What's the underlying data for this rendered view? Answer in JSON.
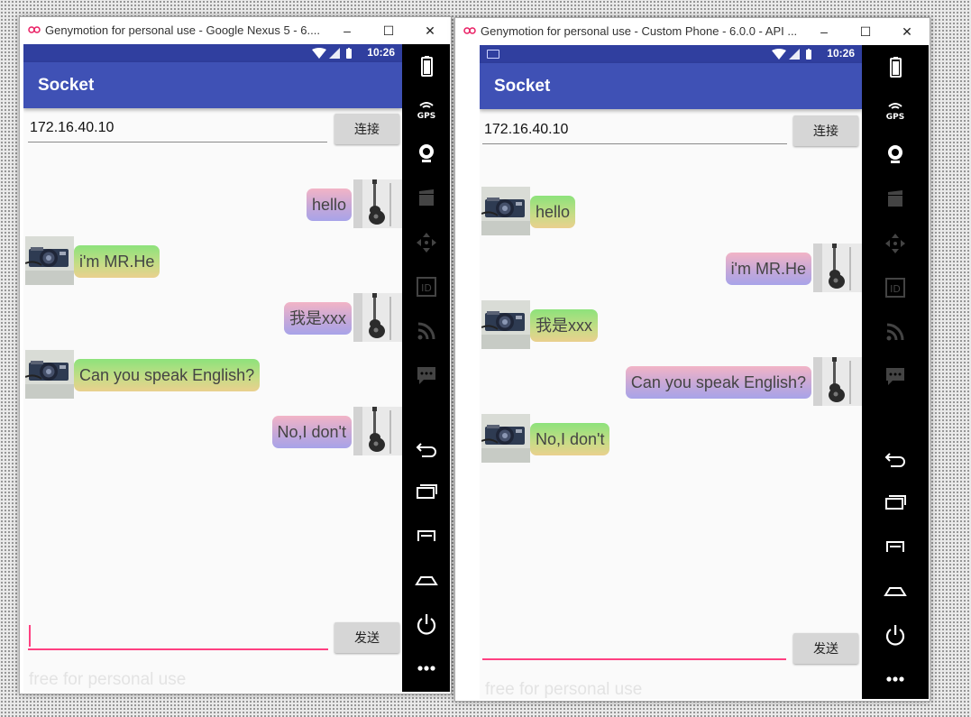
{
  "windows": [
    {
      "title": "Genymotion for personal use - Google Nexus 5 - 6....",
      "status_time": "10:26",
      "app_title": "Socket",
      "ip_value": "172.16.40.10",
      "connect_label": "连接",
      "send_label": "发送",
      "message_input_value": "",
      "watermark": "free for personal use",
      "messages": [
        {
          "side": "sent",
          "text": "hello"
        },
        {
          "side": "recv",
          "text": "i'm MR.He"
        },
        {
          "side": "sent",
          "text": "我是xxx"
        },
        {
          "side": "recv",
          "text": "Can you speak English?"
        },
        {
          "side": "sent",
          "text": "No,I don't"
        }
      ]
    },
    {
      "title": "Genymotion for personal use - Custom Phone - 6.0.0 - API ...",
      "status_time": "10:26",
      "app_title": "Socket",
      "ip_value": "172.16.40.10",
      "connect_label": "连接",
      "send_label": "发送",
      "message_input_value": "",
      "watermark": "free for personal use",
      "messages": [
        {
          "side": "recv",
          "text": "hello"
        },
        {
          "side": "sent",
          "text": "i'm MR.He"
        },
        {
          "side": "recv",
          "text": "我是xxx"
        },
        {
          "side": "sent",
          "text": "Can you speak English?"
        },
        {
          "side": "recv",
          "text": "No,I don't"
        }
      ]
    }
  ],
  "sidebar_icons": [
    "battery-icon",
    "gps-icon",
    "webcam-icon",
    "clapper-icon",
    "dpad-icon",
    "id-icon",
    "rss-icon",
    "sms-icon",
    "back-icon",
    "recent-apps-icon",
    "menu-icon",
    "home-icon",
    "power-icon",
    "more-icon"
  ],
  "colors": {
    "primary": "#3f51b5",
    "status": "#303f9f",
    "accent": "#ff4081"
  }
}
